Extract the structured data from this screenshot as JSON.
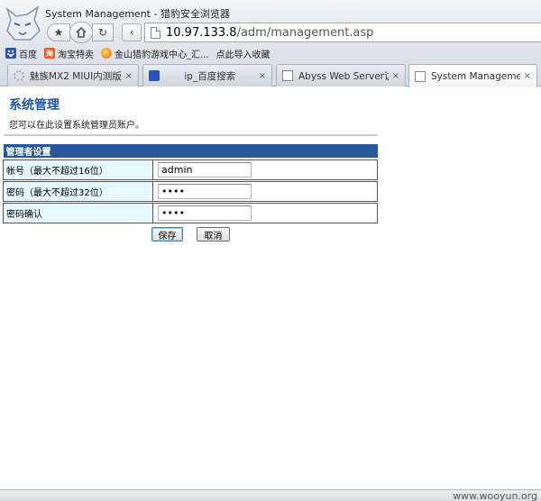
{
  "window": {
    "title": "System Management - 猎豹安全浏览器"
  },
  "address_bar": {
    "host": "10.97.133.8",
    "path": "/adm/management.asp"
  },
  "bookmarks": [
    {
      "label": "百度",
      "icon": "baidu-icon"
    },
    {
      "label": "淘宝特卖",
      "icon": "taobao-icon",
      "icon_text": "淘"
    },
    {
      "label": "金山猎豹游戏中心_汇...",
      "icon": "kingsoft-icon"
    },
    {
      "label": "点此导入收藏",
      "icon": ""
    }
  ],
  "tabs": [
    {
      "label": "魅族MX2 MIUI内测版...",
      "icon": "loading-icon",
      "active": false
    },
    {
      "label": "ip_百度搜索",
      "icon": "baidu-icon",
      "active": false
    },
    {
      "label": "Abyss Web Server访...",
      "icon": "document-icon",
      "active": false
    },
    {
      "label": "System Management",
      "icon": "document-icon",
      "active": true
    }
  ],
  "tab_close_glyph": "×",
  "page": {
    "title": "系统管理",
    "description": "您可以在此设置系统管理员账户。",
    "section_title": "管理者设置",
    "fields": [
      {
        "label": "帐号（最大不超过16位）",
        "value": "admin",
        "type": "text"
      },
      {
        "label": "密码（最大不超过32位）",
        "value": "aaaa",
        "type": "password"
      },
      {
        "label": "密码确认",
        "value": "aaaa",
        "type": "password"
      }
    ],
    "buttons": {
      "save": "保存",
      "cancel": "取消"
    }
  },
  "watermark": "www.wooyun.org",
  "colors": {
    "accent": "#2055a4",
    "section_header": "#2a579a",
    "label_bg": "#e5f7ff"
  }
}
